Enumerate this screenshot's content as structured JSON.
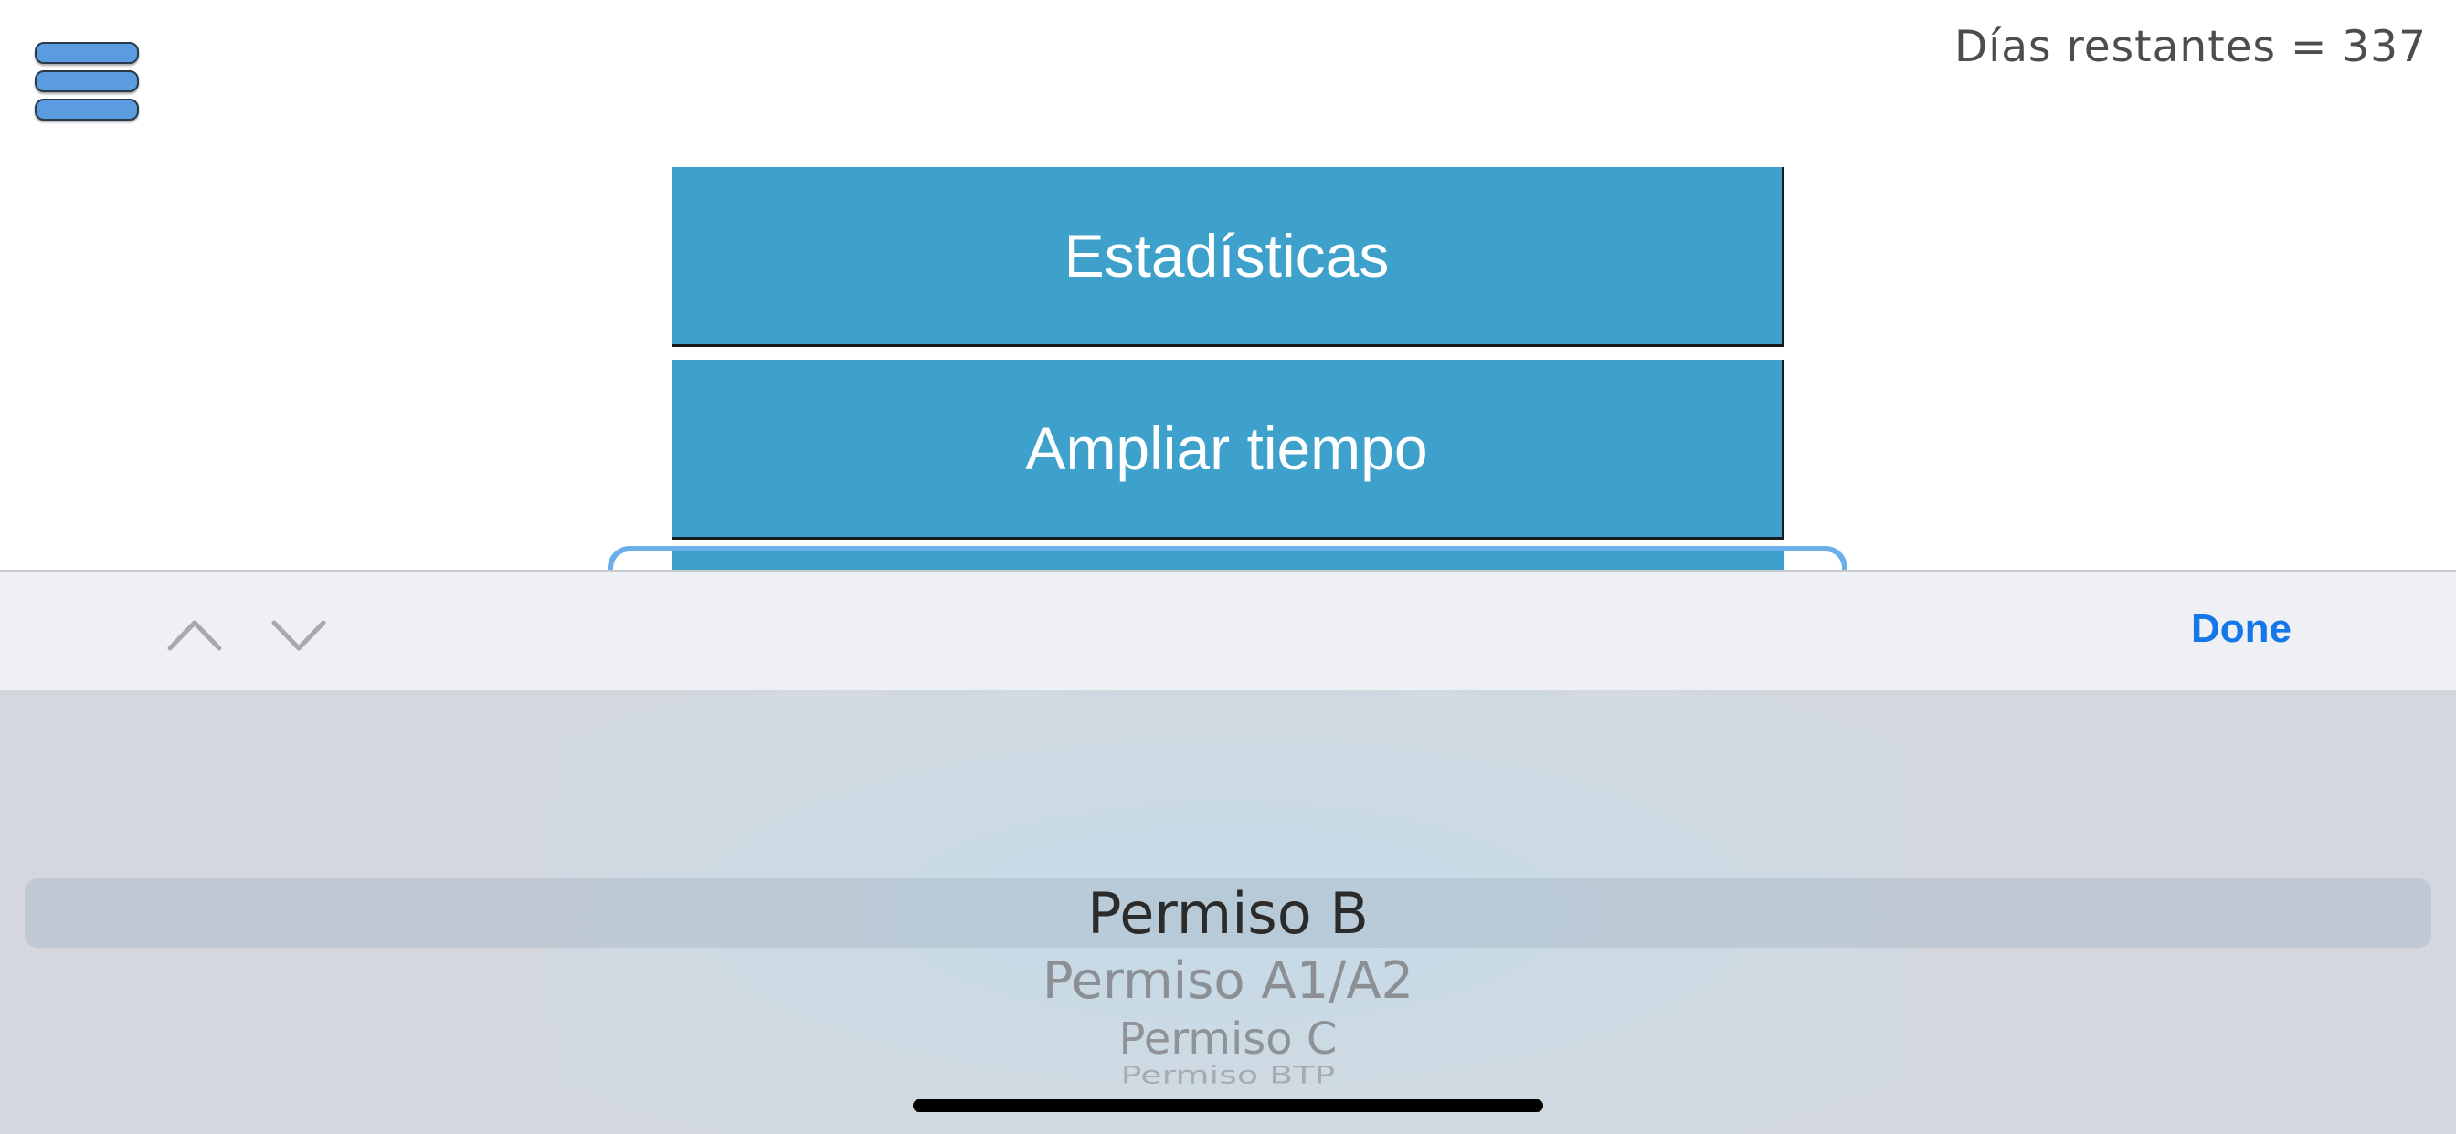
{
  "header": {
    "days_remaining": "Días restantes = 337"
  },
  "menu": {
    "buttons": [
      {
        "label": "Estadísticas"
      },
      {
        "label": "Ampliar tiempo"
      }
    ]
  },
  "toolbar": {
    "done_label": "Done",
    "prev_icon": "chevron-up-icon",
    "next_icon": "chevron-down-icon"
  },
  "picker": {
    "selected": "Permiso B",
    "items": [
      "Permiso A1/A2",
      "Permiso C",
      "Permiso BTP"
    ]
  },
  "colors": {
    "button_bg": "#3ea1cc",
    "accent": "#1577ea",
    "menu_icon": "#5b9be0"
  }
}
